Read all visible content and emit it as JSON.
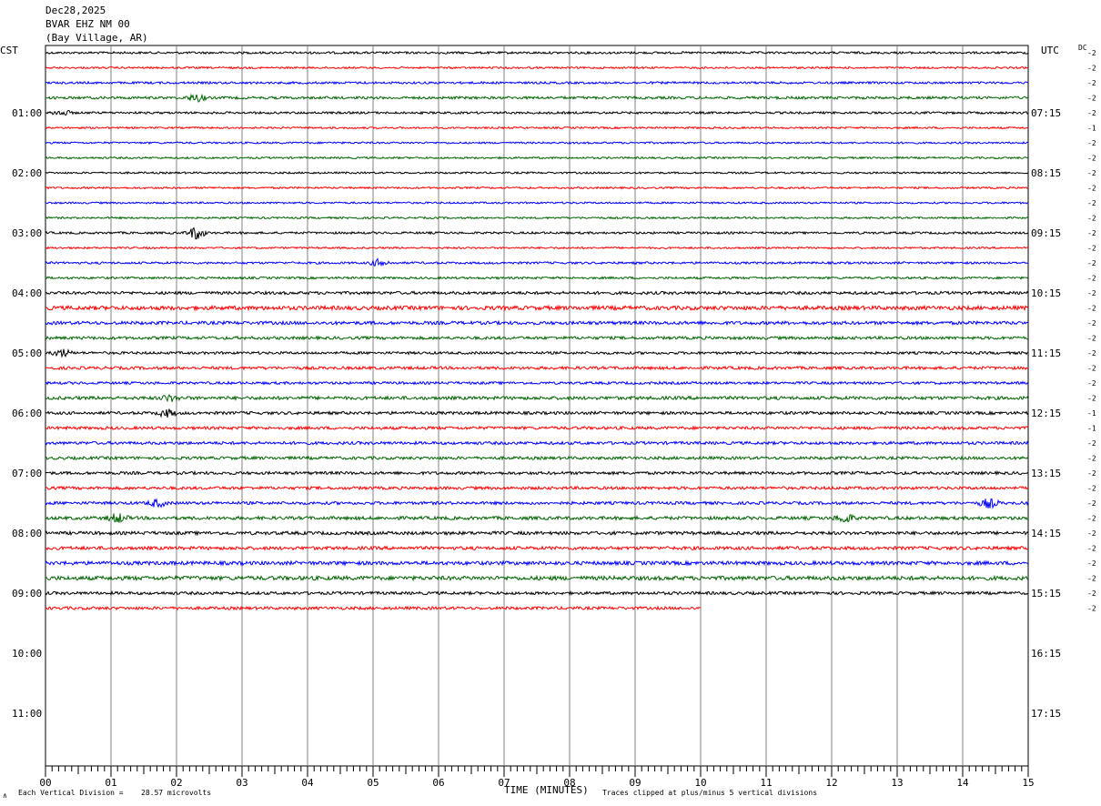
{
  "header": {
    "date": "Dec28,2025",
    "station": "BVAR EHZ NM 00",
    "location": "(Bay Village, AR)"
  },
  "left_tz": "CST",
  "right_tz": "UTC",
  "dc_label": "DC",
  "footer": {
    "scale_label": "Each Vertical Division =",
    "scale_value": "28.57 microvolts",
    "x_title": "TIME (MINUTES)",
    "clip_note": "Traces clipped at plus/minus 5 vertical divisions",
    "corner_mark": "∧"
  },
  "chart_data": {
    "type": "line",
    "subtype": "helicorder",
    "x_title": "TIME (MINUTES)",
    "x_range": [
      0,
      15
    ],
    "x_ticks": [
      "00",
      "01",
      "02",
      "03",
      "04",
      "05",
      "06",
      "07",
      "08",
      "09",
      "10",
      "11",
      "12",
      "13",
      "14",
      "15"
    ],
    "left_hour_labels": [
      "01:00",
      "02:00",
      "03:00",
      "04:00",
      "05:00",
      "06:00",
      "07:00",
      "08:00",
      "09:00",
      "10:00",
      "11:00"
    ],
    "right_hour_labels": [
      "07:15",
      "08:15",
      "09:15",
      "10:15",
      "11:15",
      "12:15",
      "13:15",
      "14:15",
      "15:15",
      "16:15",
      "17:15"
    ],
    "rows_per_hour": 4,
    "total_rows": 48,
    "trace_colors": [
      "#000000",
      "#ff0000",
      "#0000ff",
      "#006400"
    ],
    "dc_offsets": [
      "-2",
      "-2",
      "-2",
      "-2",
      "-2",
      "-1",
      "-2",
      "-2",
      "-2",
      "-2",
      "-2",
      "-2",
      "-2",
      "-2",
      "-2",
      "-2",
      "-2",
      "-2",
      "-2",
      "-2",
      "-2",
      "-2",
      "-2",
      "-2",
      "-1",
      "-1",
      "-2",
      "-2",
      "-2",
      "-2",
      "-2",
      "-2",
      "-2",
      "-2",
      "-2",
      "-2",
      "-2",
      "-2"
    ],
    "trace_end_minutes": [
      15,
      15,
      15,
      15,
      15,
      15,
      15,
      15,
      15,
      15,
      15,
      15,
      15,
      15,
      15,
      15,
      15,
      15,
      15,
      15,
      15,
      15,
      15,
      15,
      15,
      15,
      15,
      15,
      15,
      15,
      15,
      15,
      15,
      15,
      15,
      15,
      15,
      10
    ],
    "trace_noise": [
      1.2,
      1.0,
      1.2,
      1.4,
      1.2,
      1.0,
      1.0,
      1.0,
      1.0,
      1.0,
      1.0,
      1.0,
      1.2,
      1.0,
      1.2,
      1.2,
      1.6,
      2.2,
      1.8,
      1.6,
      1.4,
      1.6,
      1.4,
      1.8,
      1.6,
      1.6,
      1.6,
      1.6,
      1.6,
      1.6,
      1.6,
      1.8,
      1.8,
      1.8,
      2.0,
      2.2,
      1.6,
      1.6
    ],
    "events": [
      {
        "row": 3,
        "minute": 2.3,
        "amp": 4
      },
      {
        "row": 4,
        "minute": 0.25,
        "amp": 3
      },
      {
        "row": 12,
        "minute": 2.3,
        "amp": 7
      },
      {
        "row": 14,
        "minute": 5.1,
        "amp": 4
      },
      {
        "row": 20,
        "minute": 0.25,
        "amp": 4
      },
      {
        "row": 23,
        "minute": 1.9,
        "amp": 3
      },
      {
        "row": 24,
        "minute": 1.85,
        "amp": 4
      },
      {
        "row": 30,
        "minute": 1.7,
        "amp": 4
      },
      {
        "row": 30,
        "minute": 14.4,
        "amp": 5
      },
      {
        "row": 31,
        "minute": 1.1,
        "amp": 5
      },
      {
        "row": 31,
        "minute": 12.2,
        "amp": 5
      }
    ]
  }
}
